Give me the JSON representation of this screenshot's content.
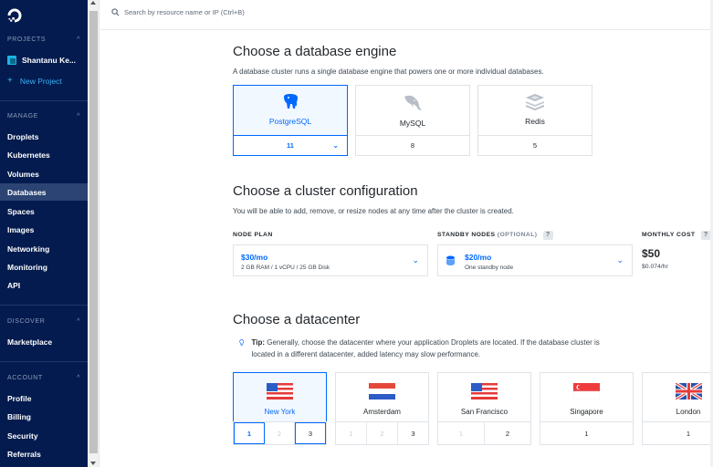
{
  "sidebar": {
    "projects_header": "PROJECTS",
    "project_name": "Shantanu Ke...",
    "new_project": "New Project",
    "manage_header": "MANAGE",
    "manage_items": [
      "Droplets",
      "Kubernetes",
      "Volumes",
      "Databases",
      "Spaces",
      "Images",
      "Networking",
      "Monitoring",
      "API"
    ],
    "active_item": "Databases",
    "discover_header": "DISCOVER",
    "discover_items": [
      "Marketplace"
    ],
    "account_header": "ACCOUNT",
    "account_items": [
      "Profile",
      "Billing",
      "Security",
      "Referrals"
    ]
  },
  "search": {
    "placeholder": "Search by resource name or IP (Ctrl+B)"
  },
  "engine": {
    "title": "Choose a database engine",
    "description": "A database cluster runs a single database engine that powers one or more individual databases.",
    "options": [
      {
        "name": "PostgreSQL",
        "version": "11",
        "icon": "postgresql-elephant-icon",
        "selected": true
      },
      {
        "name": "MySQL",
        "version": "8",
        "icon": "mysql-dolphin-icon",
        "selected": false
      },
      {
        "name": "Redis",
        "version": "5",
        "icon": "redis-stack-icon",
        "selected": false
      }
    ]
  },
  "cluster": {
    "title": "Choose a cluster configuration",
    "description": "You will be able to add, remove, or resize nodes at any time after the cluster is created.",
    "node_plan_label": "NODE PLAN",
    "node_plan_price": "$30/mo",
    "node_plan_spec": "2 GB RAM / 1 vCPU / 25 GB Disk",
    "standby_label": "STANDBY NODES",
    "standby_optional": "(OPTIONAL)",
    "standby_price": "$20/mo",
    "standby_sub": "One standby node",
    "monthly_cost_label": "MONTHLY COST",
    "monthly_cost": "$50",
    "hourly_cost": "$0.074/hr",
    "help": "?"
  },
  "datacenter": {
    "title": "Choose a datacenter",
    "tip_label": "Tip:",
    "tip_text": "Generally, choose the datacenter where your application Droplets are located. If the database cluster is located in a different datacenter, added latency may slow performance.",
    "regions": [
      {
        "name": "New York",
        "flag": "us-flag",
        "options": [
          {
            "n": "1",
            "state": "on"
          },
          {
            "n": "2",
            "state": "dis"
          },
          {
            "n": "3",
            "state": "en"
          }
        ]
      },
      {
        "name": "Amsterdam",
        "flag": "nl-flag",
        "options": [
          {
            "n": "1",
            "state": "dis"
          },
          {
            "n": "2",
            "state": "dis"
          },
          {
            "n": "3",
            "state": "en"
          }
        ]
      },
      {
        "name": "San Francisco",
        "flag": "us-flag",
        "options": [
          {
            "n": "1",
            "state": "dis"
          },
          {
            "n": "2",
            "state": "en"
          }
        ]
      },
      {
        "name": "Singapore",
        "flag": "sg-flag",
        "options": [
          {
            "n": "1",
            "state": "en"
          }
        ]
      },
      {
        "name": "London",
        "flag": "uk-flag",
        "options": [
          {
            "n": "1",
            "state": "en"
          }
        ]
      }
    ]
  },
  "colors": {
    "sidebar_bg": "#031b4e",
    "accent": "#0069ff",
    "active_item_bg": "#2b4473"
  }
}
